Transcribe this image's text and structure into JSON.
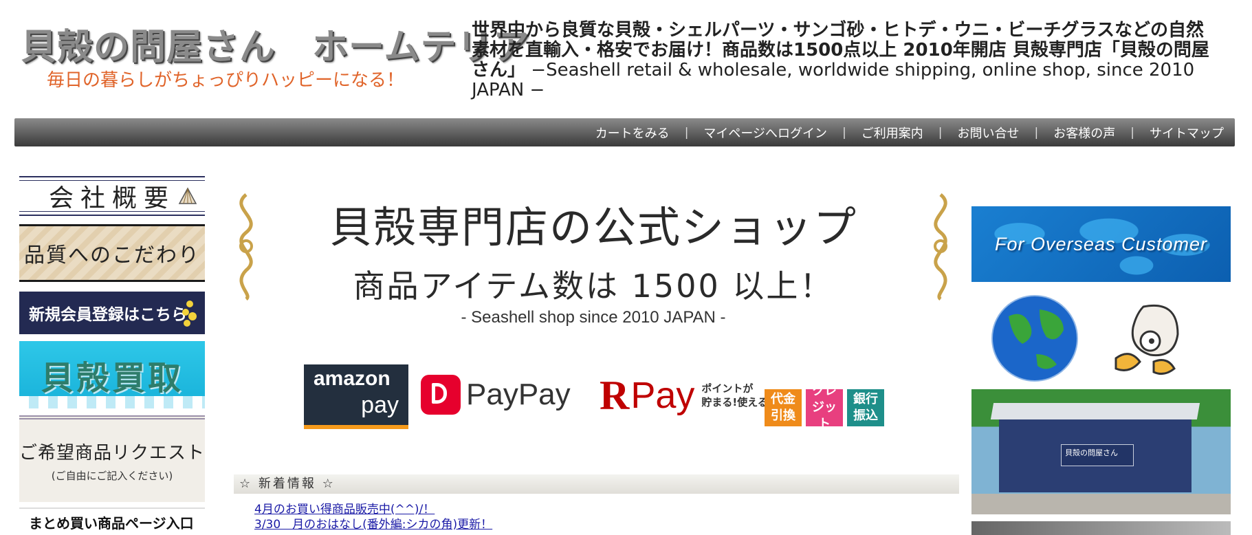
{
  "header": {
    "logo_title": "貝殻の問屋さん　ホームテリア",
    "logo_subtitle": "毎日の暮らしがちょっぴりハッピーになる！",
    "site_description": "世界中から良質な貝殻・シェルパーツ・サンゴ砂・ヒトデ・ウニ・ビーチグラスなどの自然素材を直輸入・格安でお届け！商品数は1500点以上 2010年開店 貝殻専門店「貝殻の問屋さん」",
    "site_description_en": " −Seashell retail & wholesale, worldwide shipping, online shop, since 2010 JAPAN −"
  },
  "nav": {
    "items": [
      {
        "label": "カートをみる"
      },
      {
        "label": "マイページへログイン"
      },
      {
        "label": "ご利用案内"
      },
      {
        "label": "お問い合せ"
      },
      {
        "label": "お客様の声"
      },
      {
        "label": "サイトマップ"
      }
    ],
    "separator": "|"
  },
  "left_sidebar": {
    "company": "会社概要",
    "quality": "品質へのこだわり",
    "member_signup": "新規会員登録はこちら",
    "buyback": "貝殻買取",
    "request_title": "ご希望商品リクエスト",
    "request_note": "(ご自由にご記入ください)",
    "bulk_entry": "まとめ買い商品ページ入口"
  },
  "hero": {
    "title": "貝殻専門店の公式ショップ",
    "count_text": "商品アイテム数は 1500 以上！",
    "tagline": "- Seashell shop since 2010 JAPAN -"
  },
  "payments": {
    "amazon_top": "amazon",
    "amazon_bottom": "pay",
    "paypay": "PayPay",
    "rpay_r": "R",
    "rpay_pay": "Pay",
    "rpay_point_line1": "ポイントが",
    "rpay_point_line2": "貯まる!使える!",
    "cod": "代金引換",
    "credit": "クレジット",
    "bank": "銀行振込"
  },
  "news": {
    "heading": "☆ 新着情報 ☆",
    "items": [
      {
        "text": "4月のお買い得商品販売中(^^)/！"
      },
      {
        "text": "3/30　月のおはなし(番外編:シカの角)更新！"
      }
    ]
  },
  "right_sidebar": {
    "overseas": "For Overseas Customer",
    "building_sign": "貝殻の問屋さん"
  },
  "colors": {
    "nav_dark": "#3a3a3a",
    "logo_subtitle": "#e0642a",
    "member_bg": "#232a52",
    "buyback_bg": "#1fbde2",
    "link": "#1a1aa6",
    "amazon_bg": "#232f3e",
    "paypay_red": "#e6002d",
    "rpay_red": "#bf0000",
    "cod": "#ef8b1a",
    "credit": "#e83f7f",
    "bank": "#1e8f8a"
  }
}
